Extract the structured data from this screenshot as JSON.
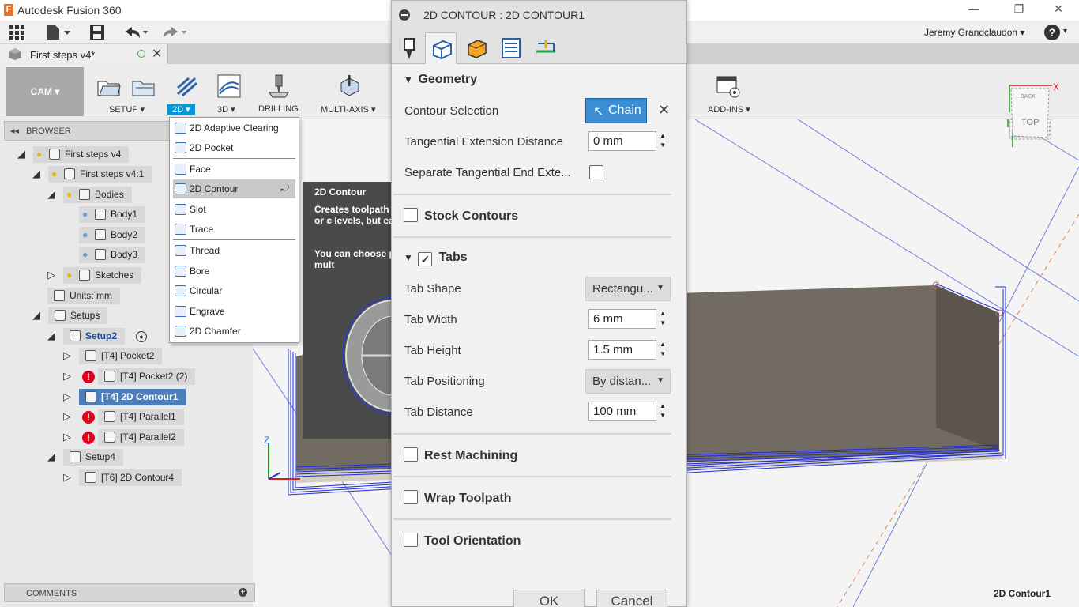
{
  "window": {
    "app_title": "Autodesk Fusion 360",
    "logo": "F",
    "minimize": "—",
    "restore": "❐",
    "close": "✕"
  },
  "qat": {
    "user": "Jeremy Grandclaudon ▾",
    "help": "?"
  },
  "doc_tab": {
    "name": "First steps v4*"
  },
  "toolbar": {
    "workspace": "CAM ▾",
    "groups": [
      {
        "label": "SETUP ▾"
      },
      {
        "label": "2D ▾"
      },
      {
        "label": "3D ▾"
      },
      {
        "label": "DRILLING"
      },
      {
        "label": "MULTI-AXIS ▾"
      },
      {
        "label": "ADD-INS ▾"
      }
    ]
  },
  "browser": {
    "header": "BROWSER",
    "rows": [
      {
        "label": "First steps v4"
      },
      {
        "label": "First steps v4:1"
      },
      {
        "label": "Bodies"
      },
      {
        "label": "Body1"
      },
      {
        "label": "Body2"
      },
      {
        "label": "Body3"
      },
      {
        "label": "Sketches"
      },
      {
        "label": "Units: mm"
      },
      {
        "label": "Setups"
      },
      {
        "label": "Setup2"
      },
      {
        "label": "[T4] Pocket2"
      },
      {
        "label": "[T4] Pocket2 (2)"
      },
      {
        "label": "[T4] 2D Contour1"
      },
      {
        "label": "[T4] Parallel1"
      },
      {
        "label": "[T4] Parallel2"
      },
      {
        "label": "Setup4"
      },
      {
        "label": "[T6] 2D Contour4"
      }
    ]
  },
  "comments": {
    "label": "COMMENTS"
  },
  "menu_2d": {
    "items": [
      {
        "label": "2D Adaptive Clearing"
      },
      {
        "label": "2D Pocket"
      },
      {
        "label": "Face"
      },
      {
        "label": "2D Contour"
      },
      {
        "label": "Slot"
      },
      {
        "label": "Trace"
      },
      {
        "label": "Thread"
      },
      {
        "label": "Bore"
      },
      {
        "label": "Circular"
      },
      {
        "label": "Engrave"
      },
      {
        "label": "2D Chamfer"
      }
    ]
  },
  "tooltip": {
    "title": "2D Contour",
    "body1": "Creates toolpath can be open or c levels, but each",
    "body2": "You can choose passes and mult"
  },
  "dialog": {
    "title": "2D CONTOUR : 2D CONTOUR1",
    "geometry": {
      "header": "Geometry",
      "contour_selection_label": "Contour Selection",
      "chain_label": "Chain",
      "clear": "✕",
      "tangential_ext_label": "Tangential Extension Distance",
      "tangential_ext_value": "0 mm",
      "separate_tangential_label": "Separate Tangential End Exte..."
    },
    "stock_contours": "Stock Contours",
    "tabs": {
      "header": "Tabs",
      "checked_mark": "✓",
      "shape_label": "Tab Shape",
      "shape_value": "Rectangu...",
      "width_label": "Tab Width",
      "width_value": "6 mm",
      "height_label": "Tab Height",
      "height_value": "1.5 mm",
      "positioning_label": "Tab Positioning",
      "positioning_value": "By distan...",
      "distance_label": "Tab Distance",
      "distance_value": "100 mm"
    },
    "rest_machining": "Rest Machining",
    "wrap_toolpath": "Wrap Toolpath",
    "tool_orientation": "Tool Orientation",
    "ok": "OK",
    "cancel": "Cancel"
  },
  "viewport": {
    "status": "2D Contour1",
    "viewcube_top": "TOP",
    "viewcube_back": "BACK",
    "axis_z": "Z"
  }
}
